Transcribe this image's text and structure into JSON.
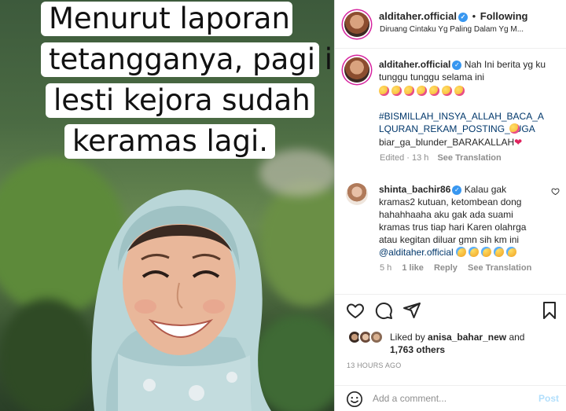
{
  "post_image": {
    "caption_lines": [
      "Menurut laporan",
      "tetangganya, pagi ini",
      "lesti kejora sudah",
      "keramas lagi."
    ]
  },
  "header": {
    "username": "alditaher.official",
    "separator": "•",
    "follow_status": "Following",
    "location": "Diruang Cintaku Yg Paling Dalam Yg M..."
  },
  "caption": {
    "username": "alditaher.official",
    "text": "Nah Ini berita yg ku tunggu tunggu selama ini",
    "hashtag": "#BISMILLAH_INSYA_ALLAH_BACA_ALQURAN_REKAM_POSTING_JUGA",
    "line2": "biar_ga_blunder_BARAKALLAH",
    "meta_time": "Edited · 13 h",
    "see_translation": "See Translation"
  },
  "comment": {
    "username": "shinta_bachir86",
    "text_lines": [
      "Kalau gak",
      "kramas2 kutuan, ketombean dong",
      "hahahhaaha aku gak ada suami",
      "kramas trus tiap hari Karen olahrga",
      "atau kegitan diluar gmn sih km ini"
    ],
    "mention": "@alditaher.official",
    "time": "5 h",
    "likes": "1 like",
    "reply": "Reply",
    "see_translation": "See Translation"
  },
  "likes": {
    "prefix": "Liked by",
    "user": "anisa_bahar_new",
    "and": "and",
    "others": "1,763 others"
  },
  "timestamp": "13 HOURS AGO",
  "comment_box": {
    "placeholder": "Add a comment...",
    "post_label": "Post"
  },
  "colors": {
    "accent": "#0095f6",
    "verified": "#3897f0",
    "hashtag": "#00376b",
    "meta": "#8e8e8e",
    "heart": "#e0245e"
  }
}
